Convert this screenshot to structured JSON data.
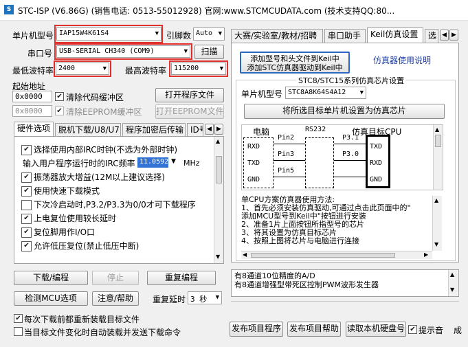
{
  "window": {
    "title": "STC-ISP (V6.86G) (销售电话: 0513-55012928) 官网:www.STCMCUDATA.com (技术支持QQ:80..."
  },
  "left": {
    "mcu_model_label": "单片机型号",
    "mcu_model_value": "IAP15W4K61S4",
    "pin_count_label": "引脚数",
    "pin_count_value": "Auto",
    "com_label": "串口号",
    "com_value": "USB-SERIAL CH340 (COM9)",
    "scan_button": "扫描",
    "min_baud_label": "最低波特率",
    "min_baud_value": "2400",
    "max_baud_label": "最高波特率",
    "max_baud_value": "115200",
    "start_addr_label": "起始地址",
    "code_addr_value": "0x0000",
    "clear_code_label": "清除代码缓冲区",
    "open_program_button": "打开程序文件",
    "eeprom_addr_value": "0x0000",
    "clear_eeprom_label": "清除EEPROM缓冲区",
    "open_eeprom_button": "打开EEPROM文件",
    "tabs": [
      "硬件选项",
      "脱机下载/U8/U7",
      "程序加密后传输",
      "ID号"
    ],
    "options": [
      {
        "label": "选择使用内部IRC时钟(不选为外部时钟)",
        "checked": true
      },
      {
        "label": "输入用户程序运行时的IRC频率",
        "freq_value": "11.0592",
        "unit": "MHz"
      },
      {
        "label": "振荡器放大增益(12M以上建议选择)",
        "checked": true
      },
      {
        "label": "使用快速下载模式",
        "checked": true
      },
      {
        "label": "下次冷启动时,P3.2/P3.3为0/0才可下载程序",
        "checked": false
      },
      {
        "label": "上电复位使用较长延时",
        "checked": true
      },
      {
        "label": "复位脚用作I/O口",
        "checked": true
      },
      {
        "label": "允许低压复位(禁止低压中断)",
        "checked": true
      }
    ],
    "download_button": "下载/编程",
    "stop_button": "停止",
    "reprogram_button": "重复编程",
    "detect_button": "检测MCU选项",
    "help_button": "注意/帮助",
    "repeat_delay_label": "重复延时",
    "repeat_delay_value": "3 秒",
    "reload_label": "每次下载前都重新装载目标文件",
    "auto_load_label": "当目标文件变化时自动装载并发送下载命令"
  },
  "right": {
    "tabs": [
      "大赛/实验室/教材/招聘",
      "串口助手",
      "Keil仿真设置",
      "选"
    ],
    "add_keil_button_line1": "添加型号和头文件到Keil中",
    "add_keil_button_line2": "添加STC仿真器驱动到Keil中",
    "emulator_help_link": "仿真器使用说明",
    "group_title": "STC8/STC15系列仿真芯片设置",
    "chip_model_label": "单片机型号",
    "chip_model_value": "STC8A8K64S4A12",
    "set_chip_button": "将所选目标单片机设置为仿真芯片",
    "diagram": {
      "pc_label": "电脑",
      "rs232_label": "RS232",
      "target_label": "仿真目标CPU",
      "pc_pins": [
        "RXD",
        "TXD",
        "GND"
      ],
      "pins": [
        "Pin2",
        "Pin3",
        "Pin5"
      ],
      "target_ports": [
        "P3.1",
        "P3.0"
      ],
      "target_pins": [
        "TXD",
        "RXD",
        "GND"
      ]
    },
    "instructions": [
      "单CPU方案仿真器使用方法:",
      "1、首先必须安装仿真驱动,可通过点击此页面中的\"",
      "添加MCU型号到Keil中\"按钮进行安装",
      "2、准备1片上面按钮所指型号的芯片",
      "3、将其设置为仿真目标芯片",
      "4、按照上图将芯片与电脑进行连接"
    ],
    "status_lines": [
      "有8通道10位精度的A/D",
      "有8通道增强型带死区控制PWM波形发生器"
    ],
    "publish_program_button": "发布项目程序",
    "publish_help_button": "发布项目帮助",
    "read_disk_button": "读取本机硬盘号",
    "prompt_sound_label": "提示音",
    "success_label": "成"
  }
}
